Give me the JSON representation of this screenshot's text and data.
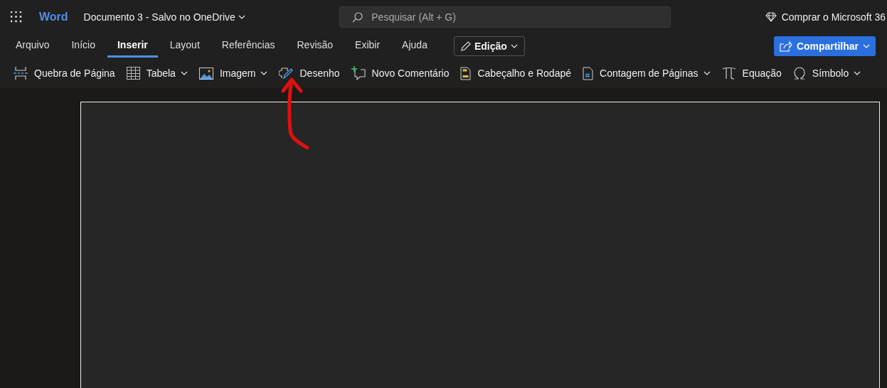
{
  "app": {
    "name": "Word",
    "document_title": "Documento 3 - Salvo no OneDrive"
  },
  "search": {
    "placeholder": "Pesquisar (Alt + G)"
  },
  "buy_link": "Comprar o Microsoft 36",
  "tabs": [
    {
      "label": "Arquivo",
      "selected": false
    },
    {
      "label": "Início",
      "selected": false
    },
    {
      "label": "Inserir",
      "selected": true
    },
    {
      "label": "Layout",
      "selected": false
    },
    {
      "label": "Referências",
      "selected": false
    },
    {
      "label": "Revisão",
      "selected": false
    },
    {
      "label": "Exibir",
      "selected": false
    },
    {
      "label": "Ajuda",
      "selected": false
    }
  ],
  "mode_button": "Edição",
  "share_button": "Compartilhar",
  "toolbar": [
    {
      "label": "Quebra de Página",
      "kind": "break",
      "dropdown": false
    },
    {
      "label": "Tabela",
      "kind": "table",
      "dropdown": true
    },
    {
      "label": "Imagem",
      "kind": "image",
      "dropdown": true
    },
    {
      "label": "Desenho",
      "kind": "drawing",
      "dropdown": false
    },
    {
      "label": "Novo Comentário",
      "kind": "comment",
      "dropdown": false
    },
    {
      "label": "Cabeçalho e Rodapé",
      "kind": "header",
      "dropdown": false
    },
    {
      "label": "Contagem de Páginas",
      "kind": "numbering",
      "dropdown": true
    },
    {
      "label": "Equação",
      "kind": "equation",
      "dropdown": false
    },
    {
      "label": "Símbolo",
      "kind": "symbol",
      "dropdown": true
    }
  ]
}
